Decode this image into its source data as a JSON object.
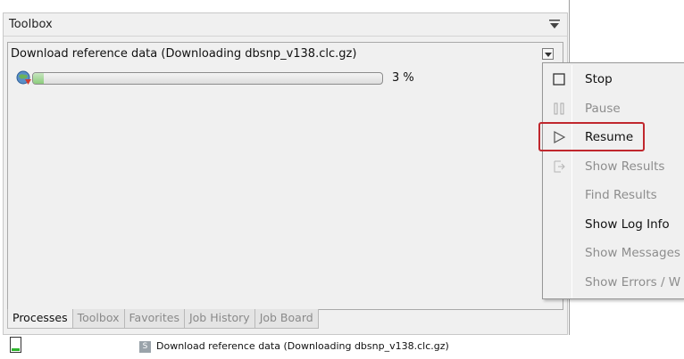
{
  "toolbox": {
    "title": "Toolbox",
    "menu_icon": "panel-menu-icon"
  },
  "process": {
    "title": "Download reference data (Downloading dbsnp_v138.clc.gz)",
    "icon": "globe-download-icon",
    "progress_percent": 3,
    "progress_text": "3 %",
    "dropdown_icon": "dropdown-arrow-icon"
  },
  "tabs": [
    {
      "label": "Processes",
      "active": true
    },
    {
      "label": "Toolbox",
      "active": false
    },
    {
      "label": "Favorites",
      "active": false
    },
    {
      "label": "Job History",
      "active": false
    },
    {
      "label": "Job Board",
      "active": false
    }
  ],
  "status_bar": {
    "icon": "memory-indicator-icon",
    "badge": "S",
    "text": "Download reference data (Downloading dbsnp_v138.clc.gz)"
  },
  "context_menu": {
    "items": [
      {
        "label": "Stop",
        "icon": "stop-icon",
        "enabled": true
      },
      {
        "label": "Pause",
        "icon": "pause-icon",
        "enabled": false
      },
      {
        "label": "Resume",
        "icon": "play-icon",
        "enabled": true,
        "highlighted": true
      },
      {
        "label": "Show Results",
        "icon": "show-results-icon",
        "enabled": false
      },
      {
        "label": "Find Results",
        "icon": "",
        "enabled": false
      },
      {
        "label": "Show Log Info",
        "icon": "",
        "enabled": true
      },
      {
        "label": "Show Messages",
        "icon": "",
        "enabled": false
      },
      {
        "label": "Show Errors / W",
        "icon": "",
        "enabled": false
      }
    ]
  },
  "colors": {
    "highlight_border": "#c0272d",
    "progress_fill": "#8ccc7c"
  }
}
